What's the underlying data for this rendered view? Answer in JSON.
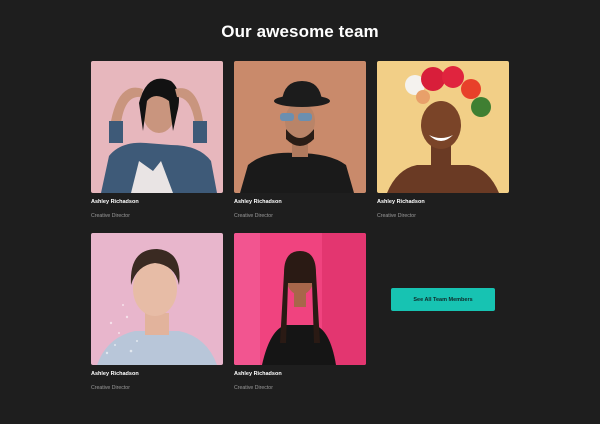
{
  "header": {
    "title": "Our awesome team"
  },
  "team": [
    {
      "name": "Ashley Richadson",
      "role": "Creative Director"
    },
    {
      "name": "Ashley Richadson",
      "role": "Creative Director"
    },
    {
      "name": "Ashley Richadson",
      "role": "Creative Director"
    },
    {
      "name": "Ashley Richadson",
      "role": "Creative Director"
    },
    {
      "name": "Ashley Richadson",
      "role": "Creative Director"
    }
  ],
  "cta": {
    "label": "See All Team Members"
  },
  "colors": {
    "background": "#1e1e1e",
    "accent": "#17c3b2"
  }
}
